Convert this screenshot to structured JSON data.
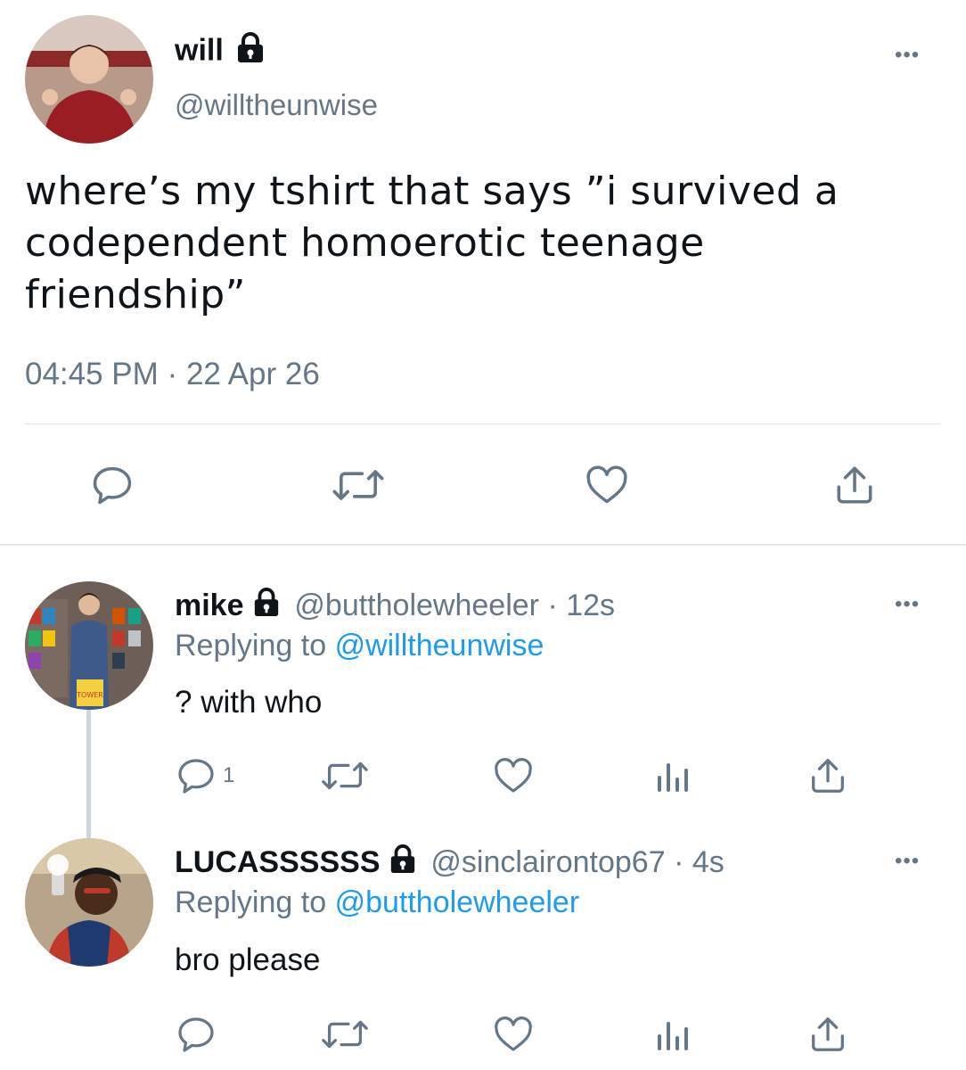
{
  "main_tweet": {
    "name": "will",
    "handle": "@willtheunwise",
    "text_lines": [
      "where’s my tshirt that says ”i survived a",
      "codependent homoerotic teenage",
      "friendship”"
    ],
    "time": "04:45 PM",
    "date": "22 Apr 26",
    "more_glyph": "•••"
  },
  "replies": [
    {
      "name": "mike",
      "handle": "@buttholewheeler",
      "age": "12s",
      "replying_label": "Replying to",
      "replying_to": "@willtheunwise",
      "text": "? with who",
      "reply_count": "1",
      "more_glyph": "•••"
    },
    {
      "name": "LUCASSSSSS",
      "handle": "@sinclairontop67",
      "age": "4s",
      "replying_label": "Replying to",
      "replying_to": "@buttholewheeler",
      "text": "bro please",
      "reply_count": "",
      "more_glyph": "•••"
    }
  ],
  "separator": "·",
  "colors": {
    "link": "#1d9bf0",
    "muted": "#657786",
    "divider": "#e1e8ed"
  }
}
